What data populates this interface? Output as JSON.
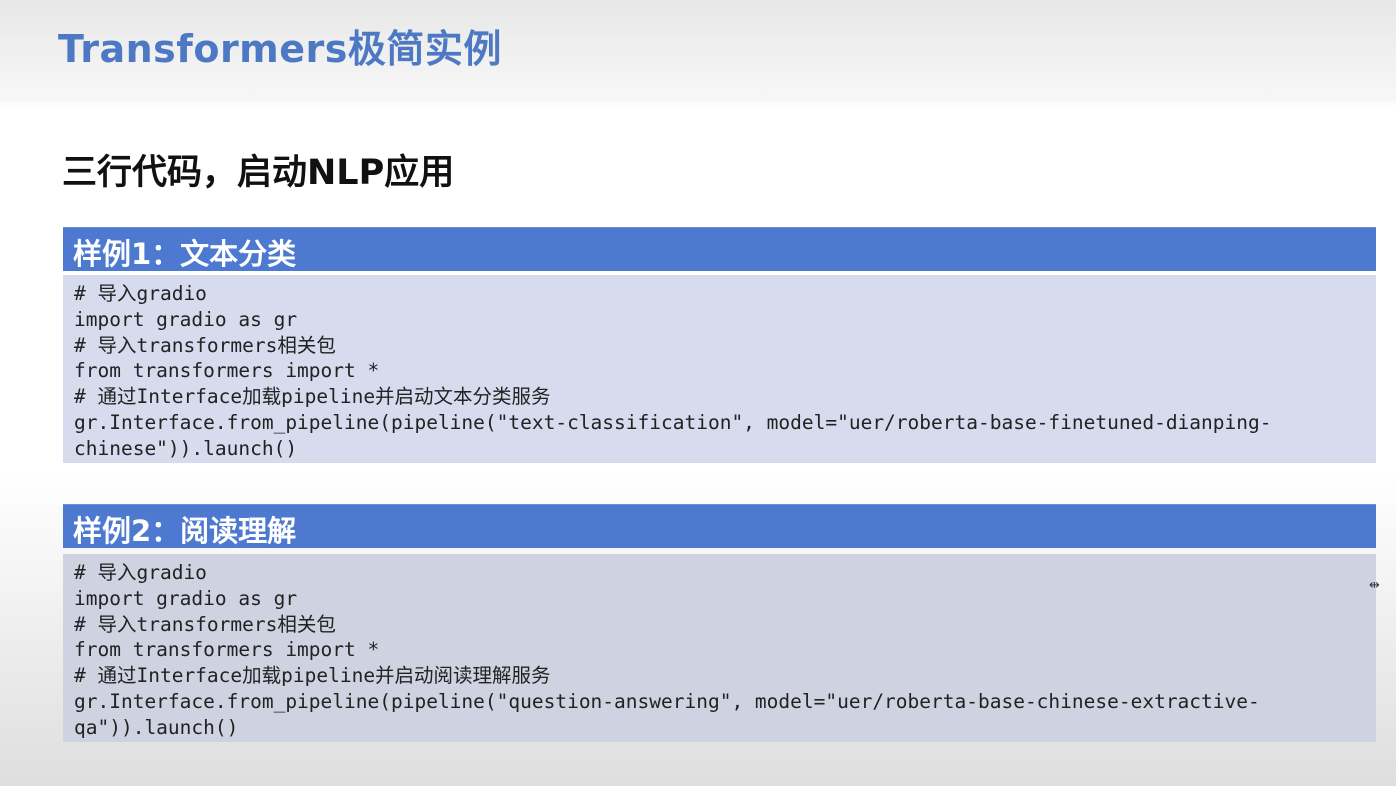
{
  "slide": {
    "title": "Transformers极简实例",
    "subtitle": "三行代码，启动NLP应用"
  },
  "examples": [
    {
      "header": "样例1：文本分类",
      "code_lines": [
        "# 导入gradio",
        "import gradio as gr",
        "# 导入transformers相关包",
        "from transformers import *",
        "# 通过Interface加载pipeline并启动文本分类服务",
        "gr.Interface.from_pipeline(pipeline(\"text-classification\", model=\"uer/roberta-base-finetuned-dianping-",
        "chinese\")).launch()"
      ]
    },
    {
      "header": "样例2：阅读理解",
      "code_lines": [
        "# 导入gradio",
        "import gradio as gr",
        "# 导入transformers相关包",
        "from transformers import *",
        "# 通过Interface加载pipeline并启动阅读理解服务",
        "gr.Interface.from_pipeline(pipeline(\"question-answering\", model=\"uer/roberta-base-chinese-extractive-",
        "qa\")).launch()"
      ]
    }
  ],
  "icons": {
    "cursor": "resize-cursor-icon"
  }
}
